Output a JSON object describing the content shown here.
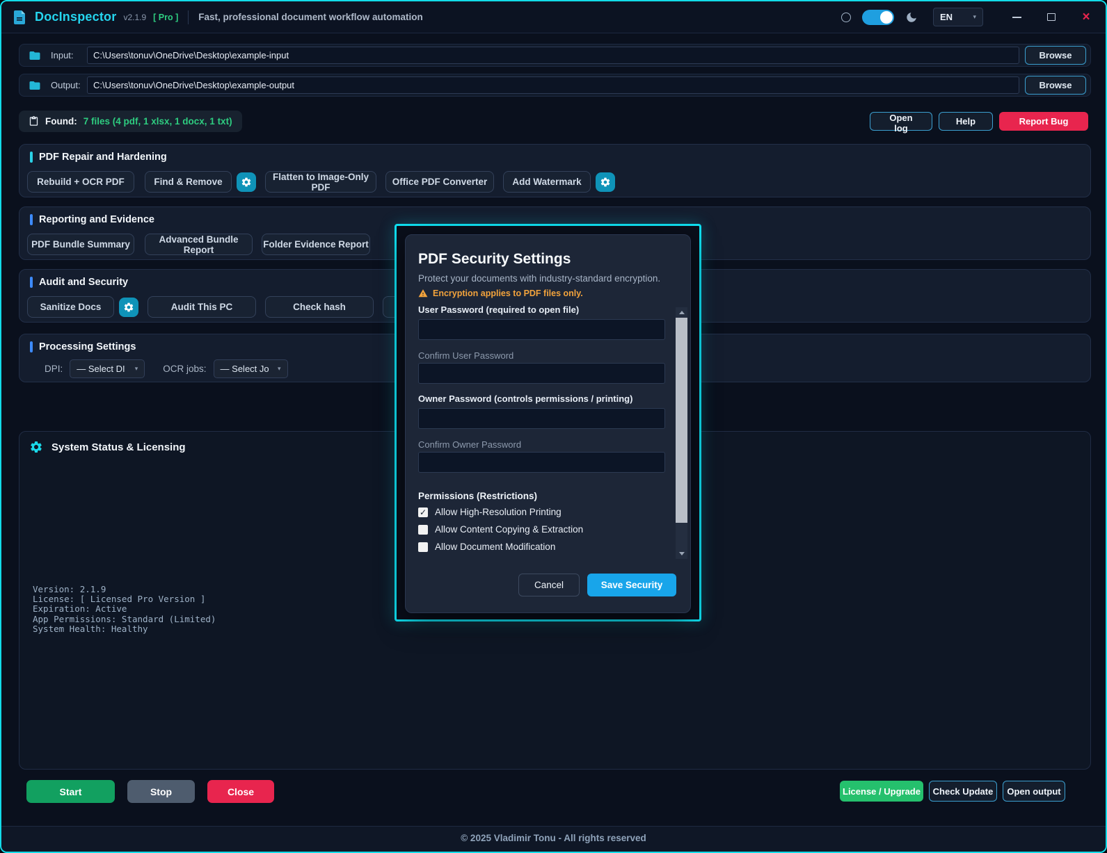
{
  "header": {
    "app_name": "DocInspector",
    "version": "v2.1.9",
    "badge": "[ Pro ]",
    "tagline": "Fast, professional document workflow automation",
    "language": "EN"
  },
  "paths": {
    "input_label": "Input:",
    "input_value": "C:\\Users\\tonuv\\OneDrive\\Desktop\\example-input",
    "output_label": "Output:",
    "output_value": "C:\\Users\\tonuv\\OneDrive\\Desktop\\example-output",
    "browse_label": "Browse"
  },
  "found": {
    "label": "Found:",
    "value": "7 files (4 pdf, 1 xlsx, 1 docx, 1 txt)"
  },
  "top_actions": {
    "open_log": "Open log",
    "help": "Help",
    "report_bug": "Report Bug"
  },
  "sections": {
    "repair": {
      "title": "PDF Repair and Hardening",
      "buttons": [
        "Rebuild + OCR PDF",
        "Find & Remove",
        "Flatten to Image-Only PDF",
        "Office PDF Converter",
        "Add Watermark"
      ]
    },
    "reporting": {
      "title": "Reporting and Evidence",
      "buttons": [
        "PDF Bundle Summary",
        "Advanced Bundle Report",
        "Folder Evidence Report"
      ]
    },
    "audit": {
      "title": "Audit and Security",
      "buttons": [
        "Sanitize Docs",
        "Audit This PC",
        "Check hash"
      ]
    },
    "processing": {
      "title": "Processing Settings",
      "dpi_label": "DPI:",
      "dpi_value": "— Select DI",
      "ocr_label": "OCR jobs:",
      "ocr_value": "— Select Jo"
    }
  },
  "status": {
    "title": "System Status & Licensing",
    "lines": "Version: 2.1.9\nLicense: [ Licensed Pro Version ]\nExpiration: Active\nApp Permissions: Standard (Limited)\nSystem Health: Healthy"
  },
  "actions": {
    "start": "Start",
    "stop": "Stop",
    "close": "Close",
    "license": "License / Upgrade",
    "check_update": "Check Update",
    "open_output": "Open output"
  },
  "footer": {
    "copyright": "© 2025 Vladimir Tonu - All rights reserved"
  },
  "modal": {
    "title": "PDF Security Settings",
    "subtitle": "Protect your documents with industry-standard encryption.",
    "warning": "Encryption applies to PDF files only.",
    "fields": {
      "user_password_label": "User Password (required to open file)",
      "confirm_user_label": "Confirm User Password",
      "owner_password_label": "Owner Password (controls permissions / printing)",
      "confirm_owner_label": "Confirm Owner Password"
    },
    "permissions": {
      "title": "Permissions (Restrictions)",
      "items": [
        {
          "label": "Allow High-Resolution Printing",
          "checked": true
        },
        {
          "label": "Allow Content Copying & Extraction",
          "checked": false
        },
        {
          "label": "Allow Document Modification",
          "checked": false
        }
      ]
    },
    "cancel": "Cancel",
    "save": "Save Security"
  },
  "colors": {
    "accent_cyan": "#12dce9",
    "section_bar_blue": "#3d8bfd",
    "found_green": "#2ecc80",
    "danger_red": "#e8254e",
    "start_green": "#12a060",
    "license_green": "#25c06d",
    "save_blue": "#18a5ea",
    "warning_orange": "#f2a33c"
  },
  "icons": {
    "logo": "document-logo",
    "folder": "folder-icon",
    "clipboard": "clipboard-icon",
    "gear": "gear-icon",
    "sun": "sun-icon",
    "moon": "moon-icon",
    "warning": "warning-triangle-icon"
  }
}
